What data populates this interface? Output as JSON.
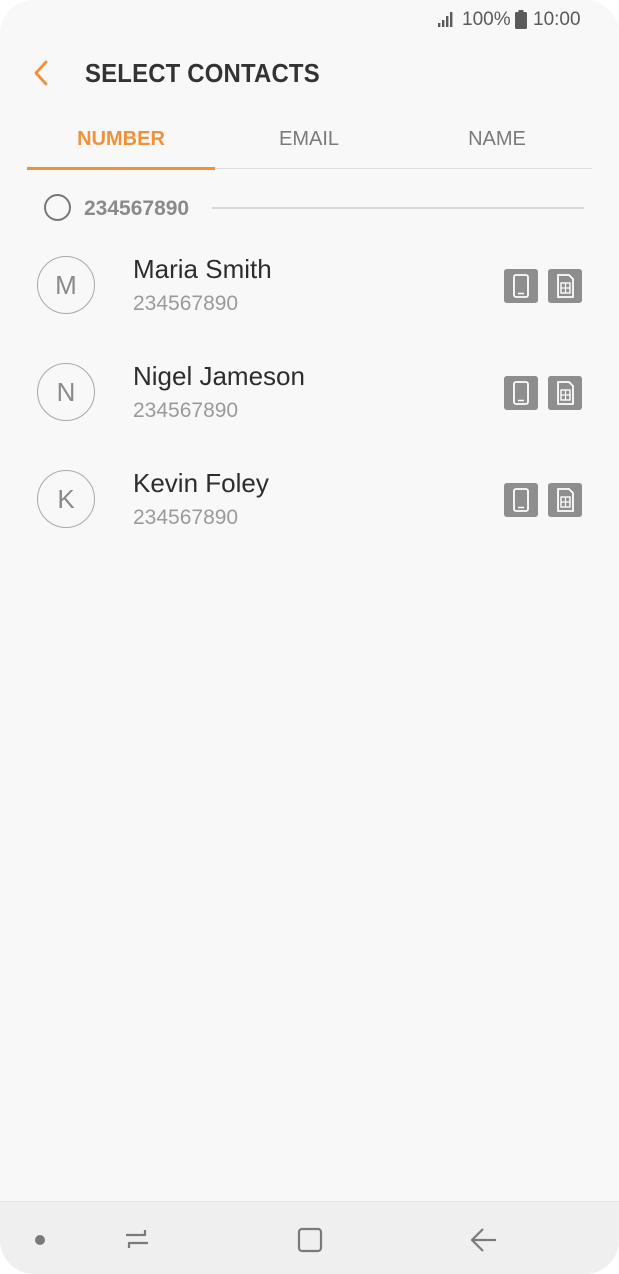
{
  "status": {
    "battery_percent": "100%",
    "time": "10:00"
  },
  "header": {
    "title": "SELECT CONTACTS"
  },
  "tabs": [
    {
      "label": "NUMBER",
      "active": true
    },
    {
      "label": "EMAIL",
      "active": false
    },
    {
      "label": "NAME",
      "active": false
    }
  ],
  "select_row": {
    "number": "234567890"
  },
  "contacts": [
    {
      "initial": "M",
      "name": "Maria Smith",
      "number": "234567890"
    },
    {
      "initial": "N",
      "name": "Nigel Jameson",
      "number": "234567890"
    },
    {
      "initial": "K",
      "name": "Kevin Foley",
      "number": "234567890"
    }
  ],
  "colors": {
    "accent": "#f0913a",
    "background": "#f8f8f8",
    "icon_gray": "#8e8e8e"
  },
  "icons": [
    "signal-icon",
    "battery-icon",
    "back-arrow-icon",
    "phone-device-icon",
    "sim-card-icon",
    "recent-apps-icon",
    "home-icon",
    "nav-back-icon"
  ]
}
